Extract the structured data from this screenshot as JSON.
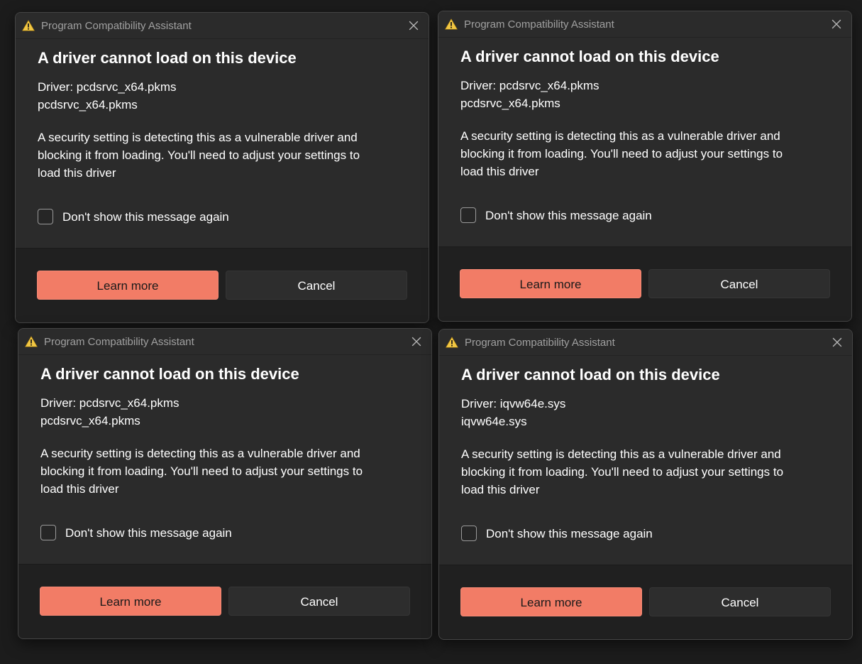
{
  "colors": {
    "background": "#1c1c1c",
    "dialog_bg": "#2b2b2b",
    "footer_bg": "#202020",
    "accent": "#f27c66",
    "warning_icon": "#f2c744"
  },
  "dialogs": [
    {
      "title": "Program Compatibility Assistant",
      "heading": "A driver cannot load on this device",
      "driver_label": "Driver: pcdsrvc_x64.pkms",
      "driver_file": "pcdsrvc_x64.pkms",
      "message_lines": [
        "A security setting is detecting this as a vulnerable driver and",
        "blocking it from loading. You'll need to adjust your settings to",
        "load this driver"
      ],
      "checkbox_label": "Don't show this message again",
      "checkbox_checked": false,
      "primary_button": "Learn more",
      "secondary_button": "Cancel",
      "icons": {
        "warning": "warning-triangle-icon",
        "close": "close-icon"
      }
    },
    {
      "title": "Program Compatibility Assistant",
      "heading": "A driver cannot load on this device",
      "driver_label": "Driver: pcdsrvc_x64.pkms",
      "driver_file": "pcdsrvc_x64.pkms",
      "message_lines": [
        "A security setting is detecting this as a vulnerable driver and",
        "blocking it from loading. You'll need to adjust your settings to",
        "load this driver"
      ],
      "checkbox_label": "Don't show this message again",
      "checkbox_checked": false,
      "primary_button": "Learn more",
      "secondary_button": "Cancel",
      "icons": {
        "warning": "warning-triangle-icon",
        "close": "close-icon"
      }
    },
    {
      "title": "Program Compatibility Assistant",
      "heading": "A driver cannot load on this device",
      "driver_label": "Driver: pcdsrvc_x64.pkms",
      "driver_file": "pcdsrvc_x64.pkms",
      "message_lines": [
        "A security setting is detecting this as a vulnerable driver and",
        "blocking it from loading. You'll need to adjust your settings to",
        "load this driver"
      ],
      "checkbox_label": "Don't show this message again",
      "checkbox_checked": false,
      "primary_button": "Learn more",
      "secondary_button": "Cancel",
      "icons": {
        "warning": "warning-triangle-icon",
        "close": "close-icon"
      }
    },
    {
      "title": "Program Compatibility Assistant",
      "heading": "A driver cannot load on this device",
      "driver_label": "Driver: iqvw64e.sys",
      "driver_file": "iqvw64e.sys",
      "message_lines": [
        "A security setting is detecting this as a vulnerable driver and",
        "blocking it from loading. You'll need to adjust your settings to",
        "load this driver"
      ],
      "checkbox_label": "Don't show this message again",
      "checkbox_checked": false,
      "primary_button": "Learn more",
      "secondary_button": "Cancel",
      "icons": {
        "warning": "warning-triangle-icon",
        "close": "close-icon"
      }
    }
  ]
}
